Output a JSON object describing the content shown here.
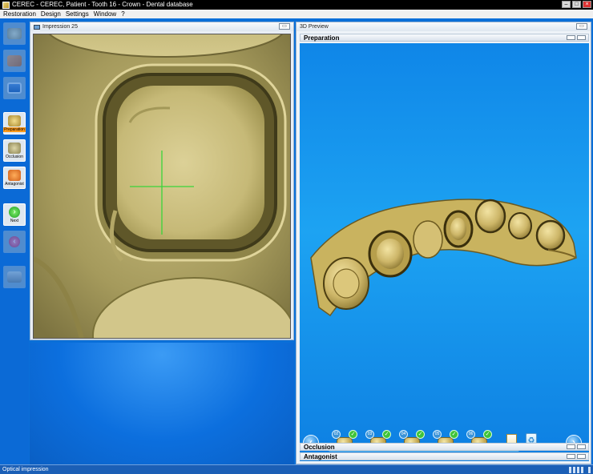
{
  "window": {
    "title": "CEREC - CEREC, Patient - Tooth  16 - Crown - Dental database",
    "controls": [
      "minimize",
      "maximize",
      "close"
    ]
  },
  "menu": [
    "Restoration",
    "Design",
    "Settings",
    "Window",
    "?"
  ],
  "toolbar": {
    "buttons": [
      {
        "name": "jaw-icon",
        "label": "",
        "state": "disabled"
      },
      {
        "name": "folder-icon",
        "label": "",
        "state": "disabled"
      },
      {
        "name": "save-icon",
        "label": "",
        "state": "disabled"
      },
      {
        "name": "preparation-icon",
        "label": "Preparation",
        "state": "active"
      },
      {
        "name": "occlusion-icon",
        "label": "Occlusion",
        "state": "normal"
      },
      {
        "name": "antagonist-icon",
        "label": "Antagonist",
        "state": "normal"
      },
      {
        "name": "next-arrow-icon",
        "label": "Next",
        "state": "normal"
      },
      {
        "name": "back-arrow-icon",
        "label": "",
        "state": "disabled"
      },
      {
        "name": "scan-icon",
        "label": "",
        "state": "disabled"
      }
    ]
  },
  "impression_panel": {
    "title": "Impression 25"
  },
  "preview_panel": {
    "title": "3D Preview",
    "sections": {
      "preparation": "Preparation",
      "occlusion": "Occlusion",
      "antagonist": "Antagonist"
    },
    "steps": [
      {
        "num": "02",
        "done": true
      },
      {
        "num": "03",
        "done": true
      },
      {
        "num": "04",
        "done": true
      },
      {
        "num": "05",
        "done": true
      },
      {
        "num": "06",
        "done": true
      }
    ],
    "step_icons": [
      "trash-bin-icon",
      "recycle-bin-icon"
    ]
  },
  "status": {
    "text": "Optical impression"
  },
  "colors": {
    "background_blue": "#0a6fd8",
    "model_gold": "#d6c275",
    "crosshair_green": "#39d43a"
  }
}
